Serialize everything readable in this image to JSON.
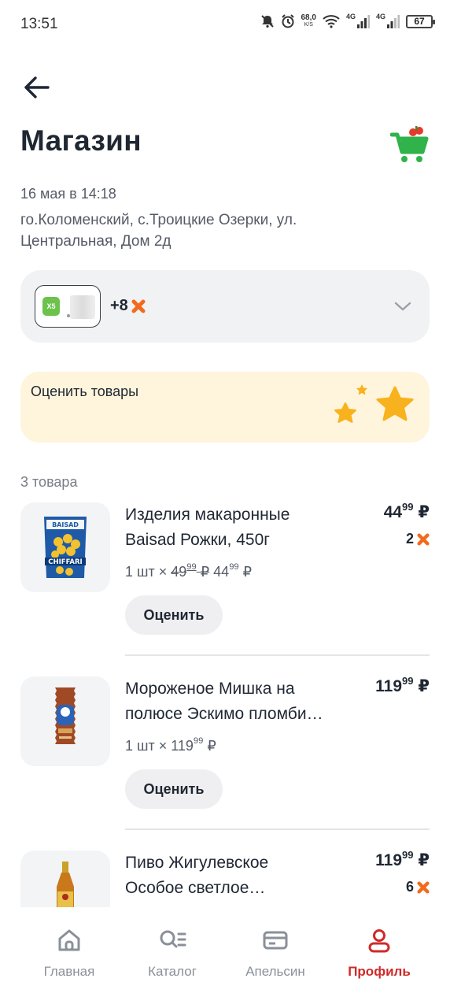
{
  "status_bar": {
    "time": "13:51",
    "speed_value": "68,0",
    "speed_unit": "K/S",
    "network1": "4G",
    "network2": "4G",
    "battery": "67"
  },
  "header": {
    "title": "Магазин"
  },
  "order": {
    "date": "16 мая в 14:18",
    "address": "го.Коломенский, с.Троицкие Озерки, ул. Центральная, Дом 2д"
  },
  "payment": {
    "logo_text": "X5",
    "bonus": "+8"
  },
  "rate_banner": {
    "text": "Оценить товары"
  },
  "items_count": "3 товара",
  "items": [
    {
      "name_line1": "Изделия макаронные",
      "name_line2": "Baisad Рожки, 450г",
      "price_int": "44",
      "price_frac": "99",
      "currency": "₽",
      "bonus": "2",
      "qty": "1 шт",
      "old_unit_int": "49",
      "old_unit_frac": "99",
      "unit_int": "44",
      "unit_frac": "99",
      "rate_label": "Оценить"
    },
    {
      "name_line1": "Мороженое Мишка на",
      "name_line2": "полюсе Эскимо пломби…",
      "price_int": "119",
      "price_frac": "99",
      "currency": "₽",
      "qty": "1 шт",
      "unit_int": "119",
      "unit_frac": "99",
      "rate_label": "Оценить"
    },
    {
      "name_line1": "Пиво Жигулевское",
      "name_line2": "Особое светлое…",
      "price_int": "119",
      "price_frac": "99",
      "currency": "₽",
      "bonus": "6"
    }
  ],
  "nav": {
    "home": "Главная",
    "catalog": "Каталог",
    "apelsin": "Апельсин",
    "profile": "Профиль"
  },
  "colors": {
    "accent": "#cf2a2a",
    "bonus_orange": "#f26b1d",
    "cart_green": "#2fb34a",
    "banner_bg": "#fff4dc"
  }
}
